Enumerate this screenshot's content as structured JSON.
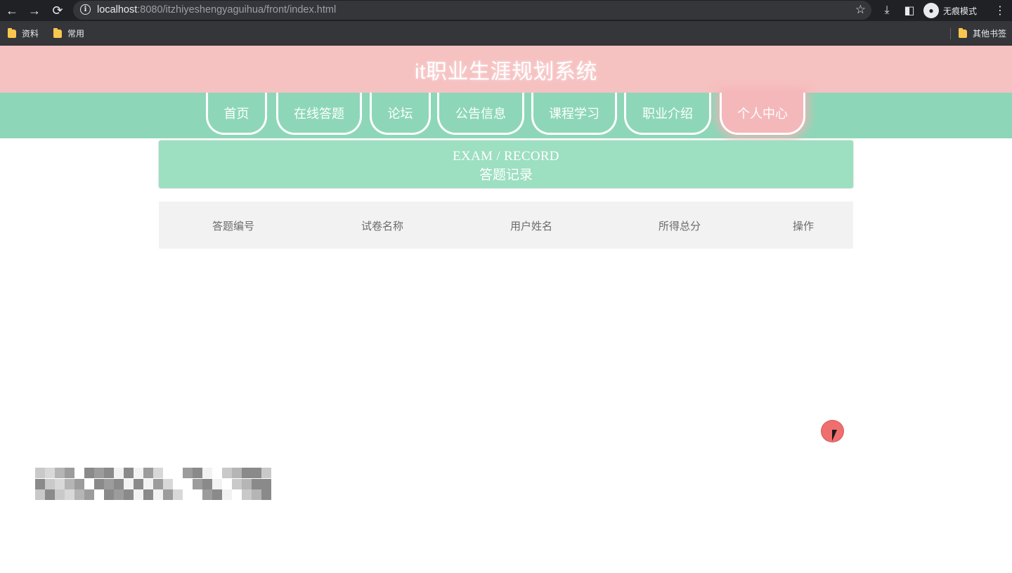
{
  "browser": {
    "url_host": "localhost",
    "url_rest": ":8080/itzhiyeshengyaguihua/front/index.html",
    "incognito_label": "无痕模式",
    "bookmarks": [
      "资料",
      "常用"
    ],
    "other_bookmarks": "其他书签"
  },
  "site": {
    "title": "it职业生涯规划系统"
  },
  "nav": {
    "items": [
      "首页",
      "在线答题",
      "论坛",
      "公告信息",
      "课程学习",
      "职业介绍",
      "个人中心"
    ],
    "active_index": 6
  },
  "banner": {
    "en": "EXAM / RECORD",
    "cn": "答题记录"
  },
  "table": {
    "headers": [
      "答题编号",
      "试卷名称",
      "用户姓名",
      "所得总分",
      "操作"
    ]
  },
  "colors": {
    "header_pink": "#f6c1c1",
    "nav_green": "#8dd7b8",
    "banner_green": "#9ddfc1",
    "active_pink": "#f4b8bb"
  }
}
